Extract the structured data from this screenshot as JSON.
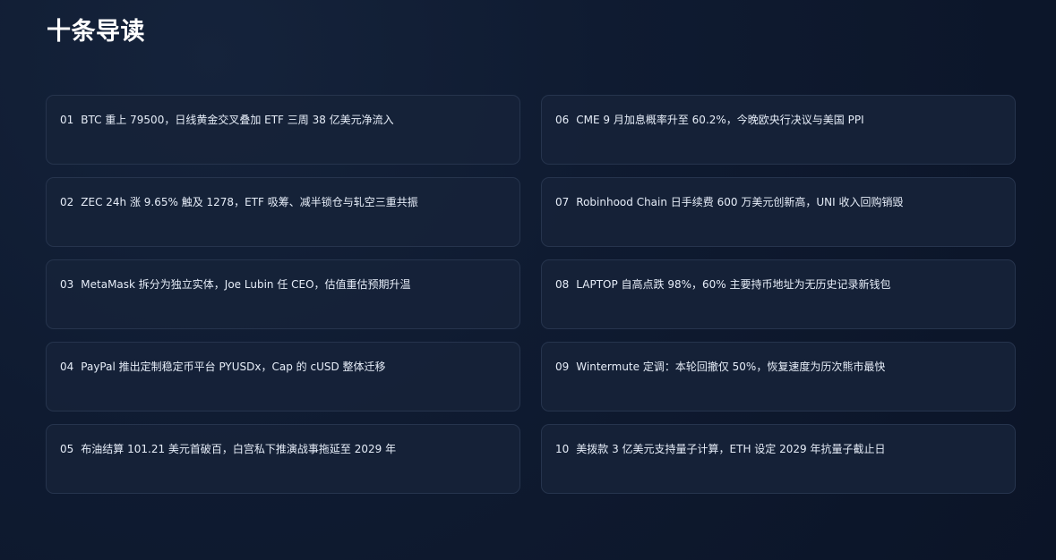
{
  "title": "十条导读",
  "items": [
    {
      "num": "01",
      "text": "BTC 重上 79500，日线黄金交叉叠加 ETF 三周 38 亿美元净流入"
    },
    {
      "num": "06",
      "text": "CME 9 月加息概率升至 60.2%，今晚欧央行决议与美国 PPI"
    },
    {
      "num": "02",
      "text": "ZEC 24h 涨 9.65% 触及 1278，ETF 吸筹、减半锁仓与轧空三重共振"
    },
    {
      "num": "07",
      "text": "Robinhood Chain 日手续费 600 万美元创新高，UNI 收入回购销毁"
    },
    {
      "num": "03",
      "text": "MetaMask 拆分为独立实体，Joe Lubin 任 CEO，估值重估预期升温"
    },
    {
      "num": "08",
      "text": "LAPTOP 自高点跌 98%，60% 主要持币地址为无历史记录新钱包"
    },
    {
      "num": "04",
      "text": "PayPal 推出定制稳定币平台 PYUSDx，Cap 的 cUSD 整体迁移"
    },
    {
      "num": "09",
      "text": "Wintermute 定调：本轮回撤仅 50%，恢复速度为历次熊市最快"
    },
    {
      "num": "05",
      "text": "布油结算 101.21 美元首破百，白宫私下推演战事拖延至 2029 年"
    },
    {
      "num": "10",
      "text": "美拨款 3 亿美元支持量子计算，ETH 设定 2029 年抗量子截止日"
    }
  ]
}
